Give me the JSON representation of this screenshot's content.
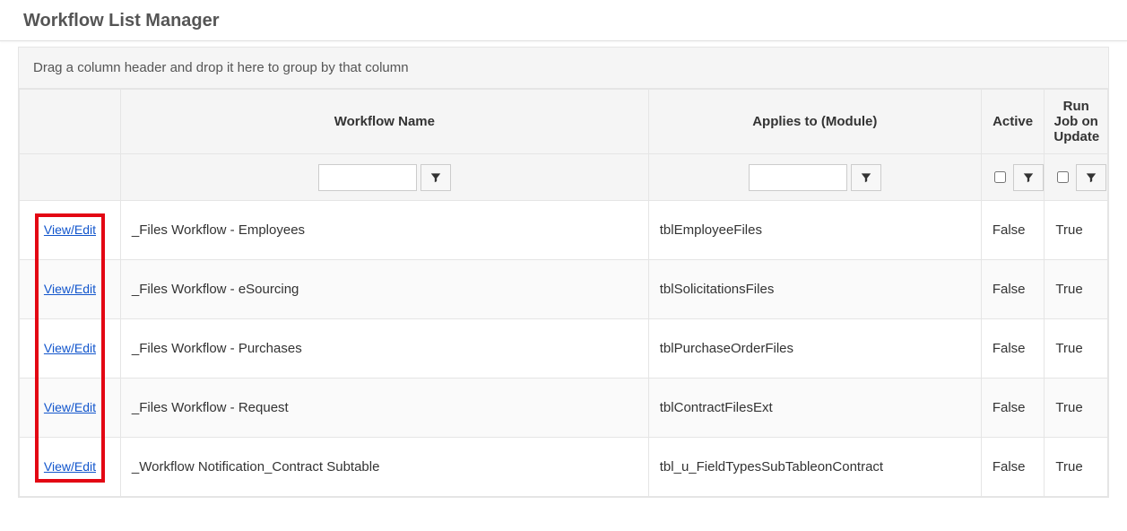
{
  "page_title": "Workflow List Manager",
  "group_hint": "Drag a column header and drop it here to group by that column",
  "columns": {
    "action": "",
    "name": "Workflow Name",
    "module": "Applies to (Module)",
    "active": "Active",
    "run": "Run Job on Update"
  },
  "filters": {
    "name_value": "",
    "module_value": "",
    "active_checked": false,
    "run_checked": false
  },
  "action_label": "View/Edit",
  "rows": [
    {
      "name": "_Files Workflow - Employees",
      "module": "tblEmployeeFiles",
      "active": "False",
      "run": "True"
    },
    {
      "name": "_Files Workflow - eSourcing",
      "module": "tblSolicitationsFiles",
      "active": "False",
      "run": "True"
    },
    {
      "name": "_Files Workflow - Purchases",
      "module": "tblPurchaseOrderFiles",
      "active": "False",
      "run": "True"
    },
    {
      "name": "_Files Workflow - Request",
      "module": "tblContractFilesExt",
      "active": "False",
      "run": "True"
    },
    {
      "name": "_Workflow Notification_Contract Subtable",
      "module": "tbl_u_FieldTypesSubTableonContract",
      "active": "False",
      "run": "True"
    }
  ]
}
